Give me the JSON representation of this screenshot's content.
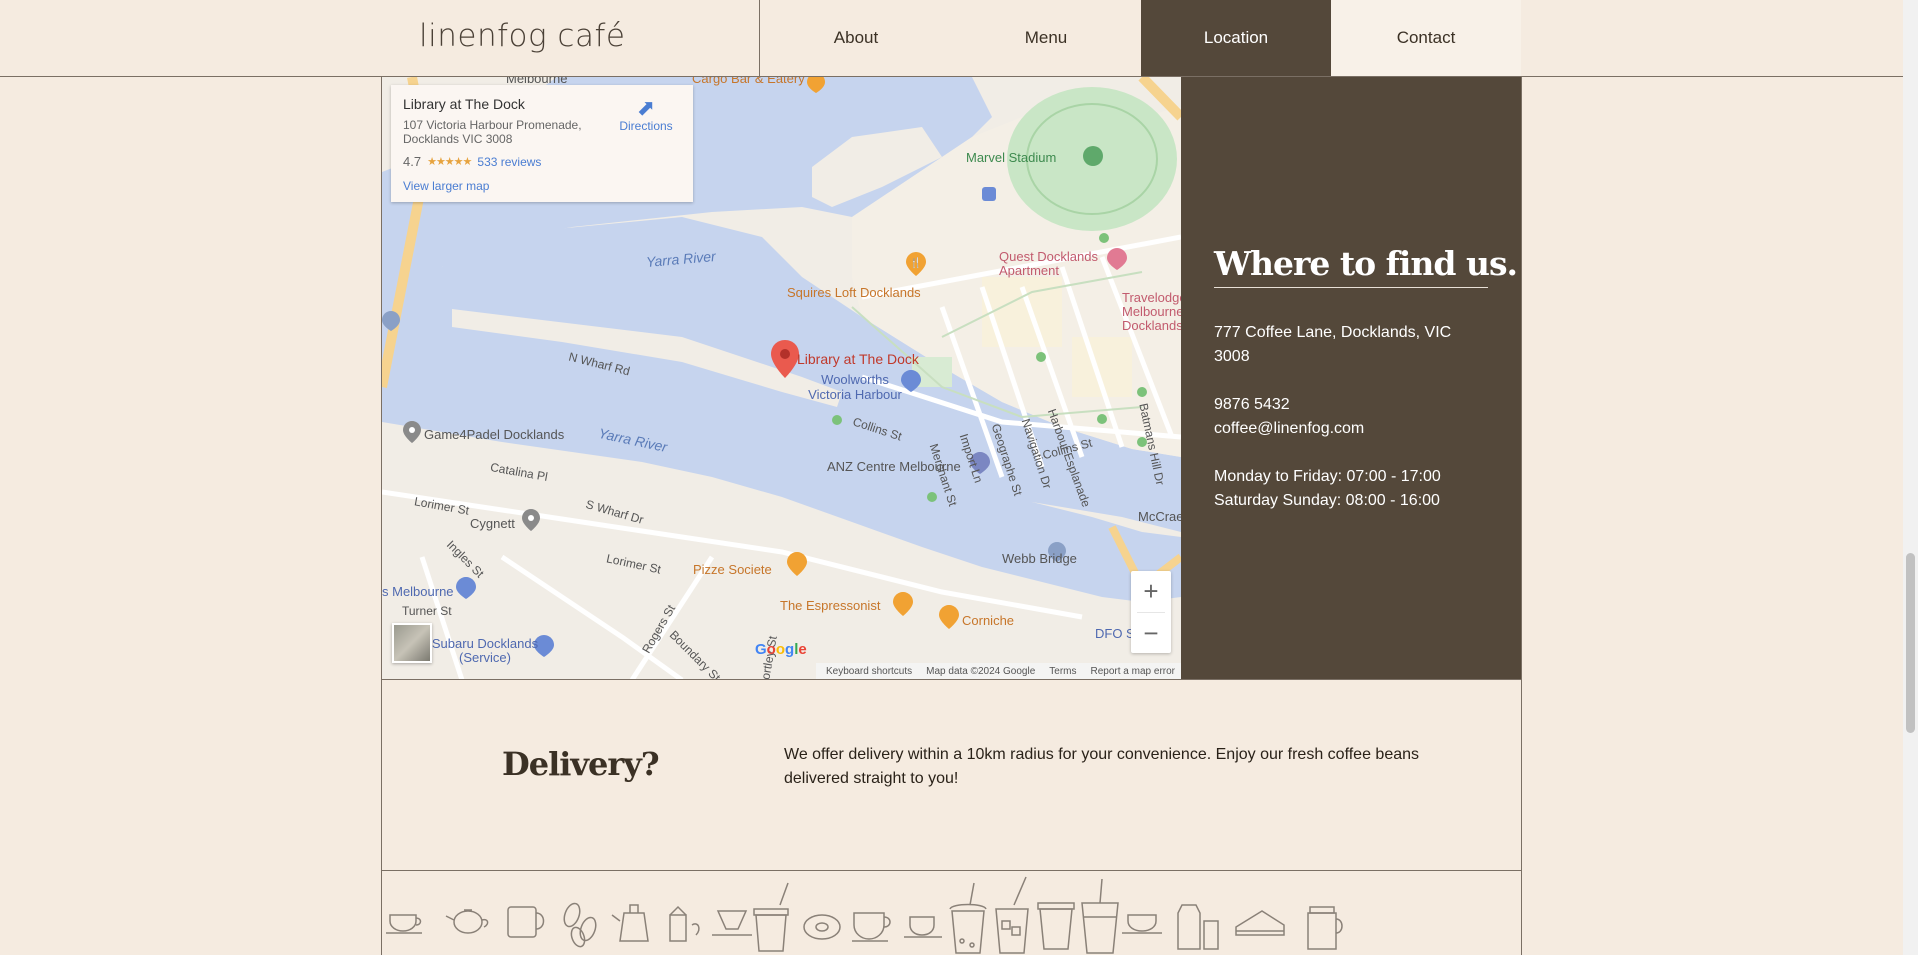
{
  "header": {
    "logo": "linenfog café",
    "nav": [
      {
        "label": "About"
      },
      {
        "label": "Menu"
      },
      {
        "label": "Location"
      },
      {
        "label": "Contact"
      }
    ]
  },
  "map": {
    "info_card": {
      "title": "Library at The Dock",
      "address": "107 Victoria Harbour Promenade, Docklands VIC 3008",
      "rating": "4.7",
      "reviews": "533 reviews",
      "larger_map": "View larger map",
      "directions": "Directions"
    },
    "labels": {
      "melbourne_top": "Melbourne",
      "cargo_bar": "Cargo Bar & Eatery",
      "marvel": "Marvel Stadium",
      "yarra_1": "Yarra River",
      "yarra_2": "Yarra River",
      "quest": "Quest Docklands Apartment",
      "squires": "Squires Loft Docklands",
      "travelodge": "Travelodge Melbourne Docklands",
      "n_wharf": "N Wharf Rd",
      "library": "Library at The Dock",
      "woolworths": "Woolworths Victoria Harbour",
      "game4padel": "Game4Padel Docklands",
      "collins_1": "Collins St",
      "collins_2": "Collins St",
      "anz": "ANZ Centre Melbourne",
      "catalina": "Catalina Pl",
      "lorimer_1": "Lorimer St",
      "lorimer_2": "Lorimer St",
      "s_wharf": "S Wharf Dr",
      "cygnett": "Cygnett",
      "ingles": "Ingles St",
      "pizze": "Pizze Societe",
      "espressonist": "The Espressonist",
      "corniche": "Corniche",
      "webb": "Webb Bridge",
      "melbourne_bottom": "s Melbourne",
      "turner": "Turner St",
      "subaru": "Subaru Docklands (Service)",
      "mccrae": "McCrae",
      "harbour_esp": "Harbour Esplanade",
      "batmans": "Batmans Hill Dr",
      "merchant": "Merchant St",
      "import": "Import Ln",
      "geographe": "Geographe St",
      "navigation": "Navigation Dr",
      "rogers": "Rogers St",
      "boundary": "Boundary St",
      "hortley": "Hortley St",
      "dfo": "DFO S"
    },
    "google": [
      "G",
      "o",
      "o",
      "g",
      "l",
      "e"
    ],
    "attribution": {
      "shortcuts": "Keyboard shortcuts",
      "data": "Map data ©2024 Google",
      "terms": "Terms",
      "report": "Report a map error"
    },
    "zoom_in": "+",
    "zoom_out": "−"
  },
  "location": {
    "title": "Where to find us.",
    "address": "777 Coffee Lane, Docklands, VIC 3008",
    "phone": "9876 5432",
    "email": "coffee@linenfog.com",
    "hours_weekday": "Monday to Friday: 07:00 - 17:00",
    "hours_weekend": "Saturday Sunday: 08:00 - 16:00"
  },
  "delivery": {
    "title": "Delivery?",
    "text": "We offer delivery within a 10km radius for your convenience. Enjoy our fresh coffee beans delivered straight to you!"
  },
  "icons": [
    "espresso-cup-icon",
    "teapot-icon",
    "mug-icon",
    "coffee-beans-icon",
    "kettle-icon",
    "milk-carton-icon",
    "pour-over-icon",
    "takeaway-cup-icon",
    "donut-icon",
    "cappuccino-cup-icon",
    "latte-cup-icon",
    "bubble-tea-icon",
    "iced-drink-icon",
    "paper-cup-icon",
    "tall-cup-icon",
    "saucer-cup-icon",
    "shakers-icon",
    "sandwich-icon",
    "jar-icon"
  ],
  "colors": {
    "background": "#f5ebe0",
    "accent": "#54483a",
    "text": "#3b3125"
  }
}
